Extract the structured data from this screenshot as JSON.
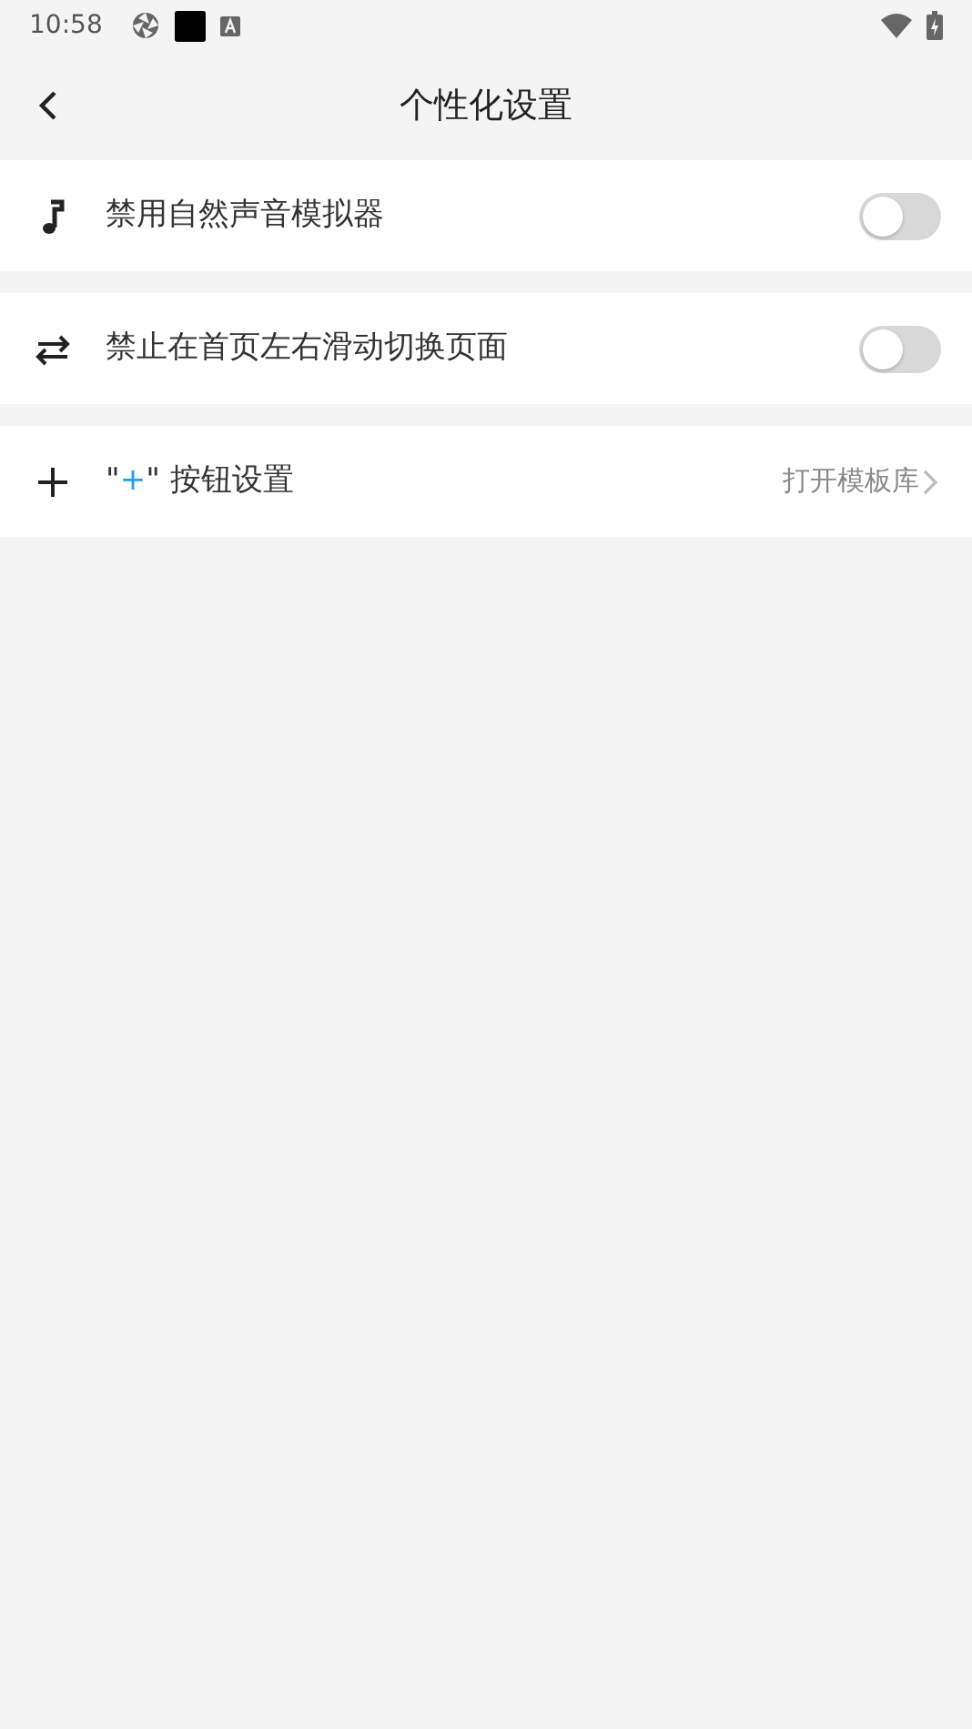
{
  "status_bar": {
    "time": "10:58"
  },
  "header": {
    "title": "个性化设置"
  },
  "rows": [
    {
      "kind": "toggle",
      "label_parts": [
        {
          "text": "禁用自然声音模拟器",
          "accent": false
        }
      ],
      "on": false
    },
    {
      "kind": "toggle",
      "label_parts": [
        {
          "text": "禁止在首页左右滑动切换页面",
          "accent": false
        }
      ],
      "on": false
    },
    {
      "kind": "link",
      "label_parts": [
        {
          "text": "\"",
          "accent": false
        },
        {
          "text": "+",
          "accent": true
        },
        {
          "text": "\" 按钮设置",
          "accent": false
        }
      ],
      "value": "打开模板库"
    }
  ]
}
